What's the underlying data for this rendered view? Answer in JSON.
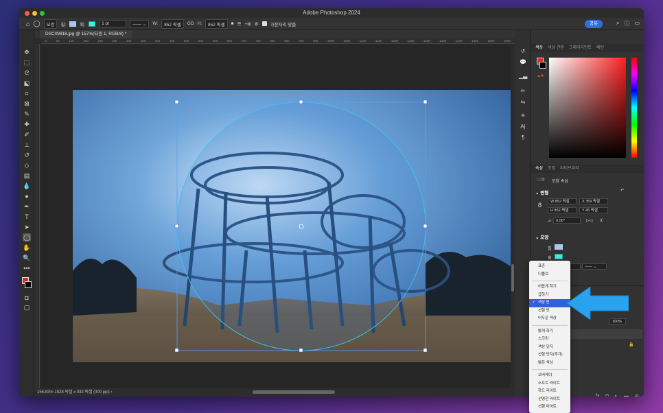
{
  "window": {
    "title": "Adobe Photoshop 2024"
  },
  "options_bar": {
    "shape_mode": "모양",
    "fill_label": "칠:",
    "stroke_label": "획:",
    "stroke_width": "1 pt",
    "width_label": "W:",
    "width_value": "852 픽셀",
    "link_label": "GD",
    "height_label": "H:",
    "height_value": "852 픽셀",
    "align_edges_label": "가장자리 맞춤",
    "share_label": "공유"
  },
  "document": {
    "tab_label": "DSC09818.jpg @ 157%(타원 1, RGB/8) *",
    "status": "156.83%   1528 픽셀 x 933 픽셀 (300 ppi)  ›",
    "ruler_ticks": [
      "0",
      "50",
      "100",
      "150",
      "200",
      "250",
      "300",
      "350",
      "400",
      "450",
      "500",
      "550",
      "600",
      "650",
      "700",
      "750",
      "800",
      "850",
      "900",
      "950",
      "1000",
      "1050",
      "1100",
      "1150",
      "1200",
      "1250",
      "1300",
      "1350",
      "1400",
      "1450",
      "1500",
      "1550"
    ]
  },
  "color_panel": {
    "tabs": [
      "색상",
      "색상 견본",
      "그레이디언트",
      "패턴"
    ],
    "active_tab": "색상"
  },
  "properties_panel": {
    "tabs": [
      "속성",
      "조정",
      "라이브러리"
    ],
    "active_tab": "속성",
    "header": "모양 속성",
    "transform_section": "변형",
    "w_label": "W",
    "w_value": "852 픽셀",
    "x_label": "X",
    "x_value": "359 픽셀",
    "h_label": "H",
    "h_value": "852 픽셀",
    "y_label": "Y",
    "y_value": "45 픽셀",
    "angle_value": "0.00°",
    "shape_section": "모양",
    "fill_label": "칠",
    "stroke_label": "획",
    "stroke_width": "1 pt",
    "opacity_value": "100%"
  },
  "blend_menu": {
    "items": [
      "표준",
      "디졸브",
      "어둡게 하기",
      "곱하기",
      "색상 번",
      "선형 번",
      "어두운 색상",
      "밝게 하기",
      "스크린",
      "색상 닷지",
      "선형 닷지(추가)",
      "밝은 색상",
      "오버레이",
      "소프트 라이트",
      "하드 라이트",
      "선명한 라이트",
      "선형 라이트"
    ],
    "selected": "색상 번"
  },
  "colors": {
    "accent": "#2e62d8",
    "fill_swatch": "#a9c6f5",
    "stroke_swatch": "#4ee8e8",
    "foreground": "#e02a20",
    "arrow": "#2aa3ef"
  }
}
